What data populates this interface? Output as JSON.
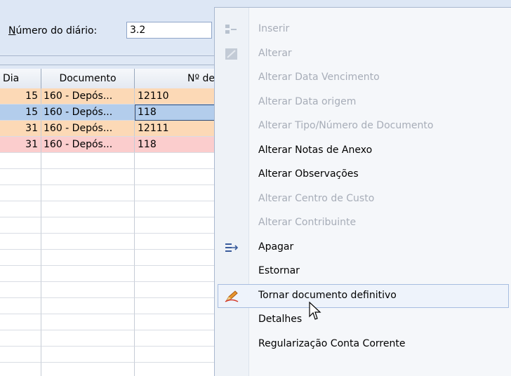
{
  "field": {
    "label_underlined": "N",
    "label_rest": "úmero do diário:",
    "value": "3.2"
  },
  "grid": {
    "headers": {
      "dia": "Dia",
      "documento": "Documento",
      "numero": "Nº de"
    },
    "rows": [
      {
        "dia": "15",
        "documento": "160 - Depós...",
        "numero": "12110",
        "color": "#fcd9b6"
      },
      {
        "dia": "15",
        "documento": "160 - Depós...",
        "numero": "118",
        "color": "#b3cdec"
      },
      {
        "dia": "31",
        "documento": "160 - Depós...",
        "numero": "12111",
        "color": "#fcd9b6"
      },
      {
        "dia": "31",
        "documento": "160 - Depós...",
        "numero": "118",
        "color": "#fbcdcd"
      }
    ]
  },
  "menu": {
    "items": [
      {
        "label": "Inserir",
        "enabled": false,
        "icon": "insert-icon"
      },
      {
        "label": "Alterar",
        "enabled": false,
        "icon": "edit-icon"
      },
      {
        "label": "Alterar Data Vencimento",
        "enabled": false
      },
      {
        "label": "Alterar Data origem",
        "enabled": false
      },
      {
        "label": "Alterar Tipo/Número de Documento",
        "enabled": false
      },
      {
        "label": "Alterar Notas de Anexo",
        "enabled": true
      },
      {
        "label": "Alterar Observações",
        "enabled": true
      },
      {
        "label": "Alterar Centro de Custo",
        "enabled": false
      },
      {
        "label": "Alterar Contribuinte",
        "enabled": false
      },
      {
        "label": "Apagar",
        "enabled": true,
        "icon": "delete-arrow-icon"
      },
      {
        "label": "Estornar",
        "enabled": true
      },
      {
        "label": "Tornar documento definitivo",
        "enabled": true,
        "icon": "pencil-icon",
        "highlighted": true
      },
      {
        "label": "Detalhes",
        "enabled": true
      },
      {
        "label": "Regularização Conta Corrente",
        "enabled": true
      }
    ]
  },
  "colors": {
    "background": "#dfe8f5",
    "highlight_border": "#a7bde0",
    "disabled_text": "#a7adb8"
  }
}
